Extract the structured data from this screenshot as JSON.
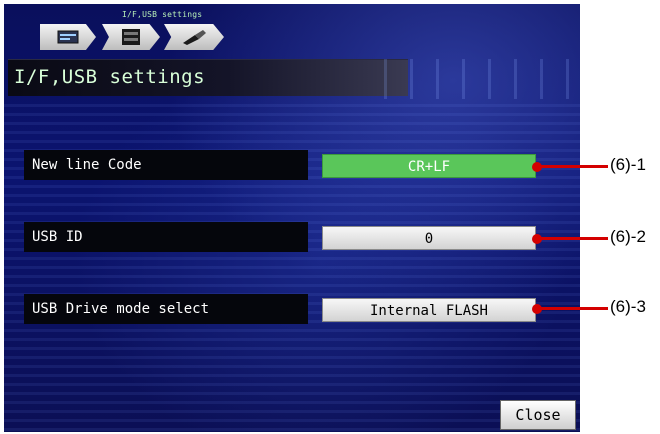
{
  "breadcrumb": {
    "caption": "I/F,USB settings",
    "icons": [
      "monitor-icon",
      "device-icon",
      "usb-plug-icon"
    ]
  },
  "page": {
    "title": "I/F,USB settings"
  },
  "settings": [
    {
      "label": "New line Code",
      "value": "CR+LF",
      "state": "selected",
      "color": "#5ac65a"
    },
    {
      "label": "USB ID",
      "value": "0",
      "state": "normal",
      "color": "#e2e2e2"
    },
    {
      "label": "USB Drive mode select",
      "value": "Internal FLASH",
      "state": "normal",
      "color": "#e2e2e2"
    }
  ],
  "close_button": {
    "label": "Close"
  },
  "callouts": [
    "(6)-1",
    "(6)-2",
    "(6)-3"
  ],
  "colors": {
    "callout": "#d40000",
    "accent_green": "#5ac65a",
    "background": "#0b1470"
  }
}
